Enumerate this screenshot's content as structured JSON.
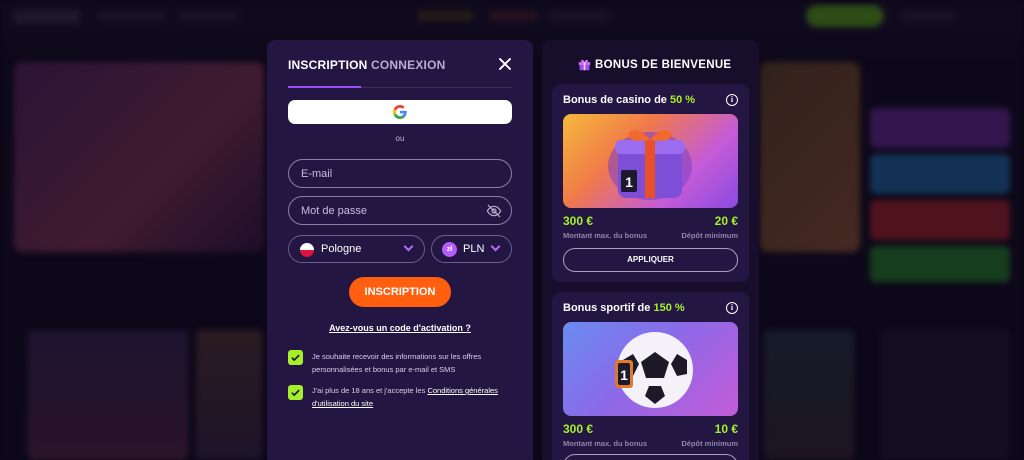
{
  "register": {
    "tab_signup": "INSCRIPTION",
    "tab_login": "CONNEXION",
    "or_text": "ou",
    "email_placeholder": "E-mail",
    "password_placeholder": "Mot de passe",
    "country": "Pologne",
    "currency": "PLN",
    "currency_symbol": "zł",
    "submit_label": "INSCRIPTION",
    "activation_link": "Avez-vous un code d'activation ?",
    "consent_offers": "Je souhaite recevoir des informations sur les offres personnalisées et bonus par e-mail et SMS",
    "consent_age_prefix": "J'ai plus de 18 ans et j'accepte les ",
    "consent_age_link": "Conditions générales d'utilisation du site"
  },
  "bonus": {
    "title": "BONUS DE BIENVENUE",
    "cards": [
      {
        "title": "Bonus de casino de ",
        "percent": "50 %",
        "max_bonus": "300 €",
        "max_bonus_label": "Montant max. du bonus",
        "min_deposit": "20 €",
        "min_deposit_label": "Dépôt minimum",
        "apply_label": "APPLIQUER"
      },
      {
        "title": "Bonus sportif de ",
        "percent": "150 %",
        "max_bonus": "300 €",
        "max_bonus_label": "Montant max. du bonus",
        "min_deposit": "10 €",
        "min_deposit_label": "Dépôt minimum"
      }
    ]
  },
  "colors": {
    "accent_green": "#a6f02b",
    "accent_orange": "#ff5f0f",
    "accent_purple": "#9d4dff",
    "modal_bg": "#231642"
  }
}
